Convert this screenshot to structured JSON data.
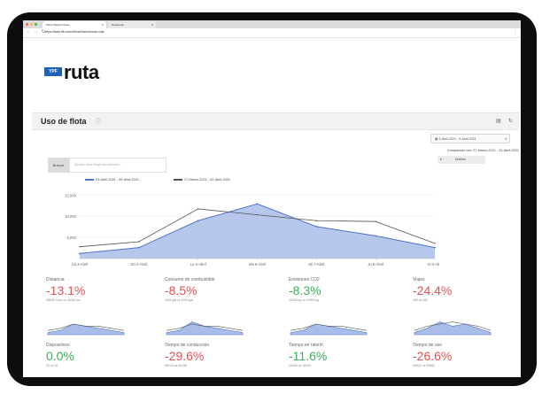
{
  "browser": {
    "active_tab": "Panel Tarjeta Flotas",
    "inactive_tab": "Nueva tab",
    "url": "https://www.ftb.com/inflota/historia/ruta-vida"
  },
  "brand": {
    "box_text": "YPF",
    "word": "ruta"
  },
  "page": {
    "title": "Uso de flota",
    "date_range": "3-Abril-2021 - 9-Abril-2021",
    "compare_text": "Comparado con: 27-Marzo-2021 - 02-Abril-2021",
    "distinto_label": "Distinto",
    "search_button": "Buscar",
    "search_placeholder": "Escribe para elegir las patentes..."
  },
  "icons": {
    "info": "info-icon",
    "print": "print-icon",
    "refresh": "refresh-icon",
    "calendar": "calendar-icon"
  },
  "colors": {
    "current_fill": "#a9bde8",
    "current_line": "#4f73c7",
    "prior_line": "#555555",
    "negative": "#e05252",
    "positive": "#3ab05b"
  },
  "chart_data": {
    "type": "area",
    "categories": [
      "Sá 3-Abril",
      "Do 4-Abril",
      "Lu 5-Abril",
      "Ma 6-Abril",
      "Mi 7-Abril",
      "Ju 8-Abril",
      "Vi 9-Abril"
    ],
    "yticks": [
      0,
      5000,
      10000,
      15000
    ],
    "ytick_labels": [
      "",
      "5,000",
      "10,000",
      "15,000"
    ],
    "ylim": [
      0,
      16000
    ],
    "series": [
      {
        "name": "03-Abril-2021 - 09-Abril-2021",
        "values": [
          1200,
          2600,
          9000,
          13000,
          7600,
          5400,
          2600
        ]
      },
      {
        "name": "27-Marzo-2021 - 02-Abril-2021",
        "values": [
          2800,
          4000,
          11800,
          10400,
          9000,
          8800,
          3600
        ]
      }
    ],
    "grid": true,
    "legend": "top-left"
  },
  "cards": [
    {
      "label": "Distancia",
      "value": "-13.1%",
      "sub": "38030.3 km vs 44061 km",
      "trend": "negative",
      "cur": [
        1,
        2,
        5,
        4,
        3,
        2,
        1
      ],
      "prev": [
        2,
        3,
        5,
        4,
        4,
        3,
        2
      ]
    },
    {
      "label": "Consumo de combustible",
      "value": "-8.5%",
      "sub": "1182 gal vs 1292 gal",
      "trend": "negative",
      "cur": [
        1,
        2,
        6,
        4,
        3,
        2,
        1
      ],
      "prev": [
        2,
        3,
        5,
        4,
        4,
        3,
        2
      ]
    },
    {
      "label": "Emisiones CO2",
      "value": "-8.3%",
      "sub": "11833 kg vs 12900 kg",
      "trend": "positive",
      "cur": [
        1,
        2,
        5,
        4,
        3,
        2,
        1
      ],
      "prev": [
        2,
        3,
        5,
        4,
        4,
        3,
        2
      ]
    },
    {
      "label": "Viajes",
      "value": "-24.4%",
      "sub": "493 vs 652",
      "trend": "negative",
      "cur": [
        1,
        3,
        6,
        4,
        5,
        3,
        1
      ],
      "prev": [
        2,
        4,
        5,
        6,
        5,
        4,
        2
      ]
    },
    {
      "label": "Dispositivos",
      "value": "0.0%",
      "sub": "20 vs 20",
      "trend": "positive",
      "cur": [
        1,
        2,
        5,
        4,
        3,
        2,
        1
      ],
      "prev": [
        2,
        3,
        5,
        4,
        4,
        3,
        2
      ]
    },
    {
      "label": "Tiempo de conducción",
      "value": "-29.6%",
      "sub": "56218 vs 64138",
      "trend": "negative",
      "cur": [
        1,
        2,
        6,
        3,
        4,
        2,
        1
      ],
      "prev": [
        2,
        3,
        5,
        4,
        4,
        3,
        2
      ]
    },
    {
      "label": "Tiempo en ralentí",
      "value": "-11.6%",
      "sub": "16446 vs 18334",
      "trend": "positive",
      "cur": [
        1,
        2,
        5,
        4,
        3,
        2,
        1
      ],
      "prev": [
        2,
        3,
        5,
        4,
        4,
        3,
        2
      ]
    },
    {
      "label": "Tiempo de uso",
      "value": "-26.6%",
      "sub": "63830 vs 93652",
      "trend": "negative",
      "cur": [
        1,
        2,
        6,
        4,
        3,
        2,
        1
      ],
      "prev": [
        2,
        3,
        5,
        4,
        4,
        3,
        2
      ]
    }
  ]
}
